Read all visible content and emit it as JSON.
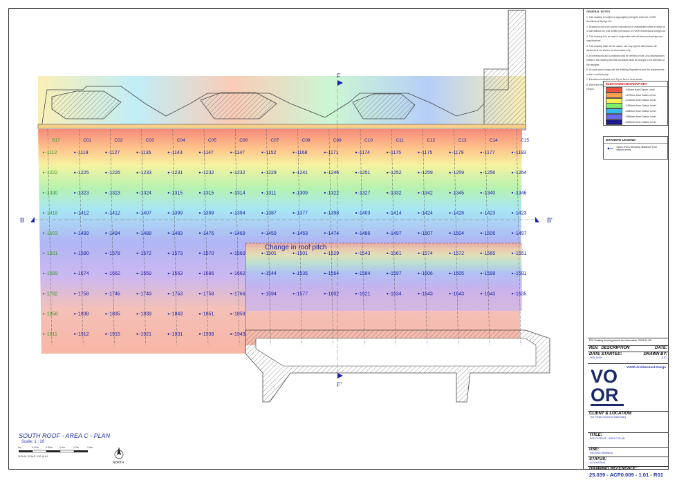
{
  "drawing": {
    "columns": [
      "B17",
      "C01",
      "C02",
      "C03",
      "C04",
      "C05",
      "C06",
      "C07",
      "C08",
      "C09",
      "C10",
      "C11",
      "C12",
      "C13",
      "C14",
      "C15"
    ],
    "rows": [
      [
        "-1112",
        "-1119",
        "-1127",
        "-1135",
        "-1143",
        "-1147",
        "-1147",
        "-1152",
        "-1168",
        "-1171",
        "-1174",
        "-1175",
        "-1175",
        "-1179",
        "-1177",
        "-1183"
      ],
      [
        "-1222",
        "-1225",
        "-1226",
        "-1233",
        "-1231",
        "-1232",
        "-1232",
        "-1229",
        "-1241",
        "-1246",
        "-1251",
        "-1252",
        "-1259",
        "-1259",
        "-1256",
        "-1264"
      ],
      [
        "-1330",
        "-1323",
        "-1323",
        "-1324",
        "-1315",
        "-1315",
        "-1314",
        "-1311",
        "-1309",
        "-1322",
        "-1327",
        "-1332",
        "-1342",
        "-1345",
        "-1340",
        "-1346"
      ],
      [
        "-1418",
        "-1412",
        "-1412",
        "-1407",
        "-1399",
        "-1399",
        "-1394",
        "-1387",
        "-1377",
        "-1398",
        "-1403",
        "-1414",
        "-1424",
        "-1428",
        "-1423",
        "-1423"
      ],
      [
        "-1503",
        "-1499",
        "-1494",
        "-1488",
        "-1483",
        "-1476",
        "-1469",
        "-1459",
        "-1453",
        "-1474",
        "-1486",
        "-1497",
        "-1507",
        "-1504",
        "-1506",
        "-1497"
      ],
      [
        "-1601",
        "-1590",
        "-1578",
        "-1572",
        "-1573",
        "-1570",
        "-1560",
        "-1501",
        "-1501",
        "-1529",
        "-1543",
        "-1561",
        "-1574",
        "-1572",
        "-1565",
        "-1551"
      ],
      [
        "-1699",
        "-1674",
        "-1662",
        "-1659",
        "-1663",
        "-1686",
        "-1662",
        "-1544",
        "-1535",
        "-1564",
        "-1584",
        "-1597",
        "-1606",
        "-1605",
        "-1598",
        "-1591"
      ],
      [
        "-1782",
        "-1758",
        "-1746",
        "-1749",
        "-1753",
        "-1758",
        "-1766",
        "-1594",
        "-1577",
        "-1602",
        "-1621",
        "-1634",
        "-1643",
        "-1643",
        "-1643",
        "-1635"
      ],
      [
        "-1858",
        "-1838",
        "-1835",
        "-1839",
        "-1843",
        "-1851",
        "-1859",
        "",
        "",
        "",
        "",
        "",
        "",
        "",
        "",
        ""
      ],
      [
        "-1911",
        "-1912",
        "-1915",
        "-1921",
        "-1931",
        "-1938",
        "-1943",
        "",
        "",
        "",
        "",
        "",
        "",
        "",
        "",
        ""
      ]
    ],
    "annotation": "Change in roof pitch",
    "section_b_left": "B",
    "section_b_right": "B'",
    "section_f_top": "F",
    "section_f_bottom": "F'",
    "title": "SOUTH ROOF - AREA C - PLAN",
    "scale": "Scale: 1 : 20",
    "scalebar_labels": [
      "0m",
      "0.40m",
      "0.80m",
      "1.0m",
      "1.2m",
      "1.6m"
    ],
    "visual_scale": "VISUAL SCALE 1:20 @ A1",
    "north": "NORTH",
    "colors": {
      "label": "#1a22aa",
      "b17": "#3a9a2a"
    }
  },
  "sidebar": {
    "notes_title": "GENERAL NOTES",
    "notes": [
      "This drawing is subject to copyright(C) all rights reserved. VOOR Architectural Design Ltd.",
      "Drawing is not to be copied, reproduced or redistributed either in whole or in part without the prior written permission of VOOR Architectural Design Ltd.",
      "This drawing is to be read in conjunction with all relevant drawings and specifications.",
      "This drawing shall not be scaled; use only figured dimensions. All dimensions are shown for information only.",
      "All dimensions and conditions shall be verified on site. Any discrepancies between this drawing and site conditions shall be brought to the attention of the designer.",
      "All work shall comply with the Building Regulations and the requirements of the Local Authority.",
      "Elevations indicated from Top to foot of heat results.",
      "When this drawing is issued in .dwg and .pdf formats it is an uncontrolled version."
    ],
    "heatmap_title": "ELEVATION HEATMAP KEY",
    "heatmap_items": [
      {
        "color": "#f2503f",
        "label": "-940mm from Datum Level"
      },
      {
        "color": "#ffa24a",
        "label": "-1120mm from Datum Level"
      },
      {
        "color": "#f6ef50",
        "label": "-1210mm from Datum Level"
      },
      {
        "color": "#7ff06a",
        "label": "-1450mm from Datum Level"
      },
      {
        "color": "#34b8f2",
        "label": "-1660mm from Datum Level"
      },
      {
        "color": "#6a6af2",
        "label": "-1860mm from Datum Level"
      },
      {
        "color": "#1a1a88",
        "label": "-2000mm from Datum Level"
      }
    ],
    "legend_title": "DRAWING LEGEND:",
    "legend_item": "Spot Level (Showing distance from datum level)"
  },
  "titleblock": {
    "rev_row": "R01   Existing drawing issued for information.   2025-01-08",
    "rev_label": "REV.",
    "description_label": "DESCRIPTION",
    "date_label": "DATE:",
    "date_started_label": "DATE STARTED:",
    "drawn_by_label": "DRAWN BY:",
    "date_started_value": "NOV 2025",
    "drawn_by_value": "KJO",
    "firm_name": "VOOR Architectural Design",
    "client_label": "CLIENT & LOCATION:",
    "client_value": "The Parish Church of Saint Mary",
    "title_label": "TITLE:",
    "title_value": "SOUTH ROOF - AREA C PLAN",
    "use_label": "USE:",
    "use_value": "RECORD DRAWING",
    "status_label": "STATUS:",
    "status_value": "AS EXISTING",
    "ref_label": "DRAWING REFERENCE:",
    "ref_value": "25.039 - ACP0.009 - 1.01 - R01"
  }
}
